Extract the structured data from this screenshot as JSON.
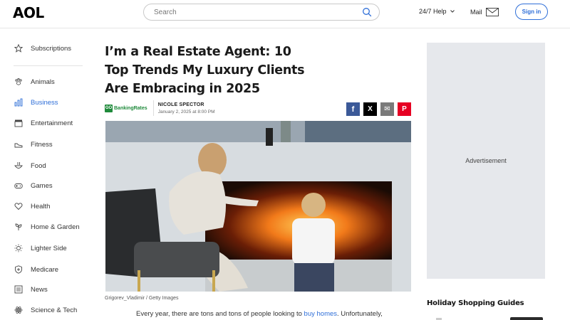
{
  "header": {
    "logo": "AOL",
    "search_placeholder": "Search",
    "help_label": "24/7 Help",
    "mail_label": "Mail",
    "signin_label": "Sign in"
  },
  "sidebar": {
    "items": [
      {
        "label": "Subscriptions",
        "icon": "star-icon"
      },
      {
        "label": "Animals",
        "icon": "paw-icon"
      },
      {
        "label": "Business",
        "icon": "chart-icon",
        "active": true
      },
      {
        "label": "Entertainment",
        "icon": "clapperboard-icon"
      },
      {
        "label": "Fitness",
        "icon": "shoe-icon"
      },
      {
        "label": "Food",
        "icon": "bowl-icon"
      },
      {
        "label": "Games",
        "icon": "gamepad-icon"
      },
      {
        "label": "Health",
        "icon": "heart-icon"
      },
      {
        "label": "Home & Garden",
        "icon": "plant-icon"
      },
      {
        "label": "Lighter Side",
        "icon": "sun-icon"
      },
      {
        "label": "Medicare",
        "icon": "shield-plus-icon"
      },
      {
        "label": "News",
        "icon": "newspaper-icon"
      },
      {
        "label": "Science & Tech",
        "icon": "atom-icon"
      }
    ]
  },
  "article": {
    "title": "I’m a Real Estate Agent: 10 Top Trends My Luxury Clients Are Embracing in 2025",
    "source": "GOBankingRates",
    "source_mark": "GO",
    "source_name": "BankingRates",
    "author": "NICOLE SPECTOR",
    "date": "January 2, 2025 at 8:00 PM",
    "image_caption": "Grigorev_Vladimir / Getty Images",
    "body_start": "Every year, there are tons and tons of people looking to ",
    "body_link": "buy homes",
    "body_end": ". Unfortunately,"
  },
  "share": {
    "facebook": "f",
    "x": "X",
    "email": "✉",
    "pinterest": "P"
  },
  "right_rail": {
    "ad_label": "Advertisement",
    "guides_heading": "Holiday Shopping Guides"
  },
  "colors": {
    "accent": "#2f6fd8",
    "facebook": "#3b5998",
    "x": "#000000",
    "email": "#7a7a7a",
    "pinterest": "#e60023",
    "gbr_green": "#1f8a3b",
    "ad_bg": "#e6e8ec"
  }
}
